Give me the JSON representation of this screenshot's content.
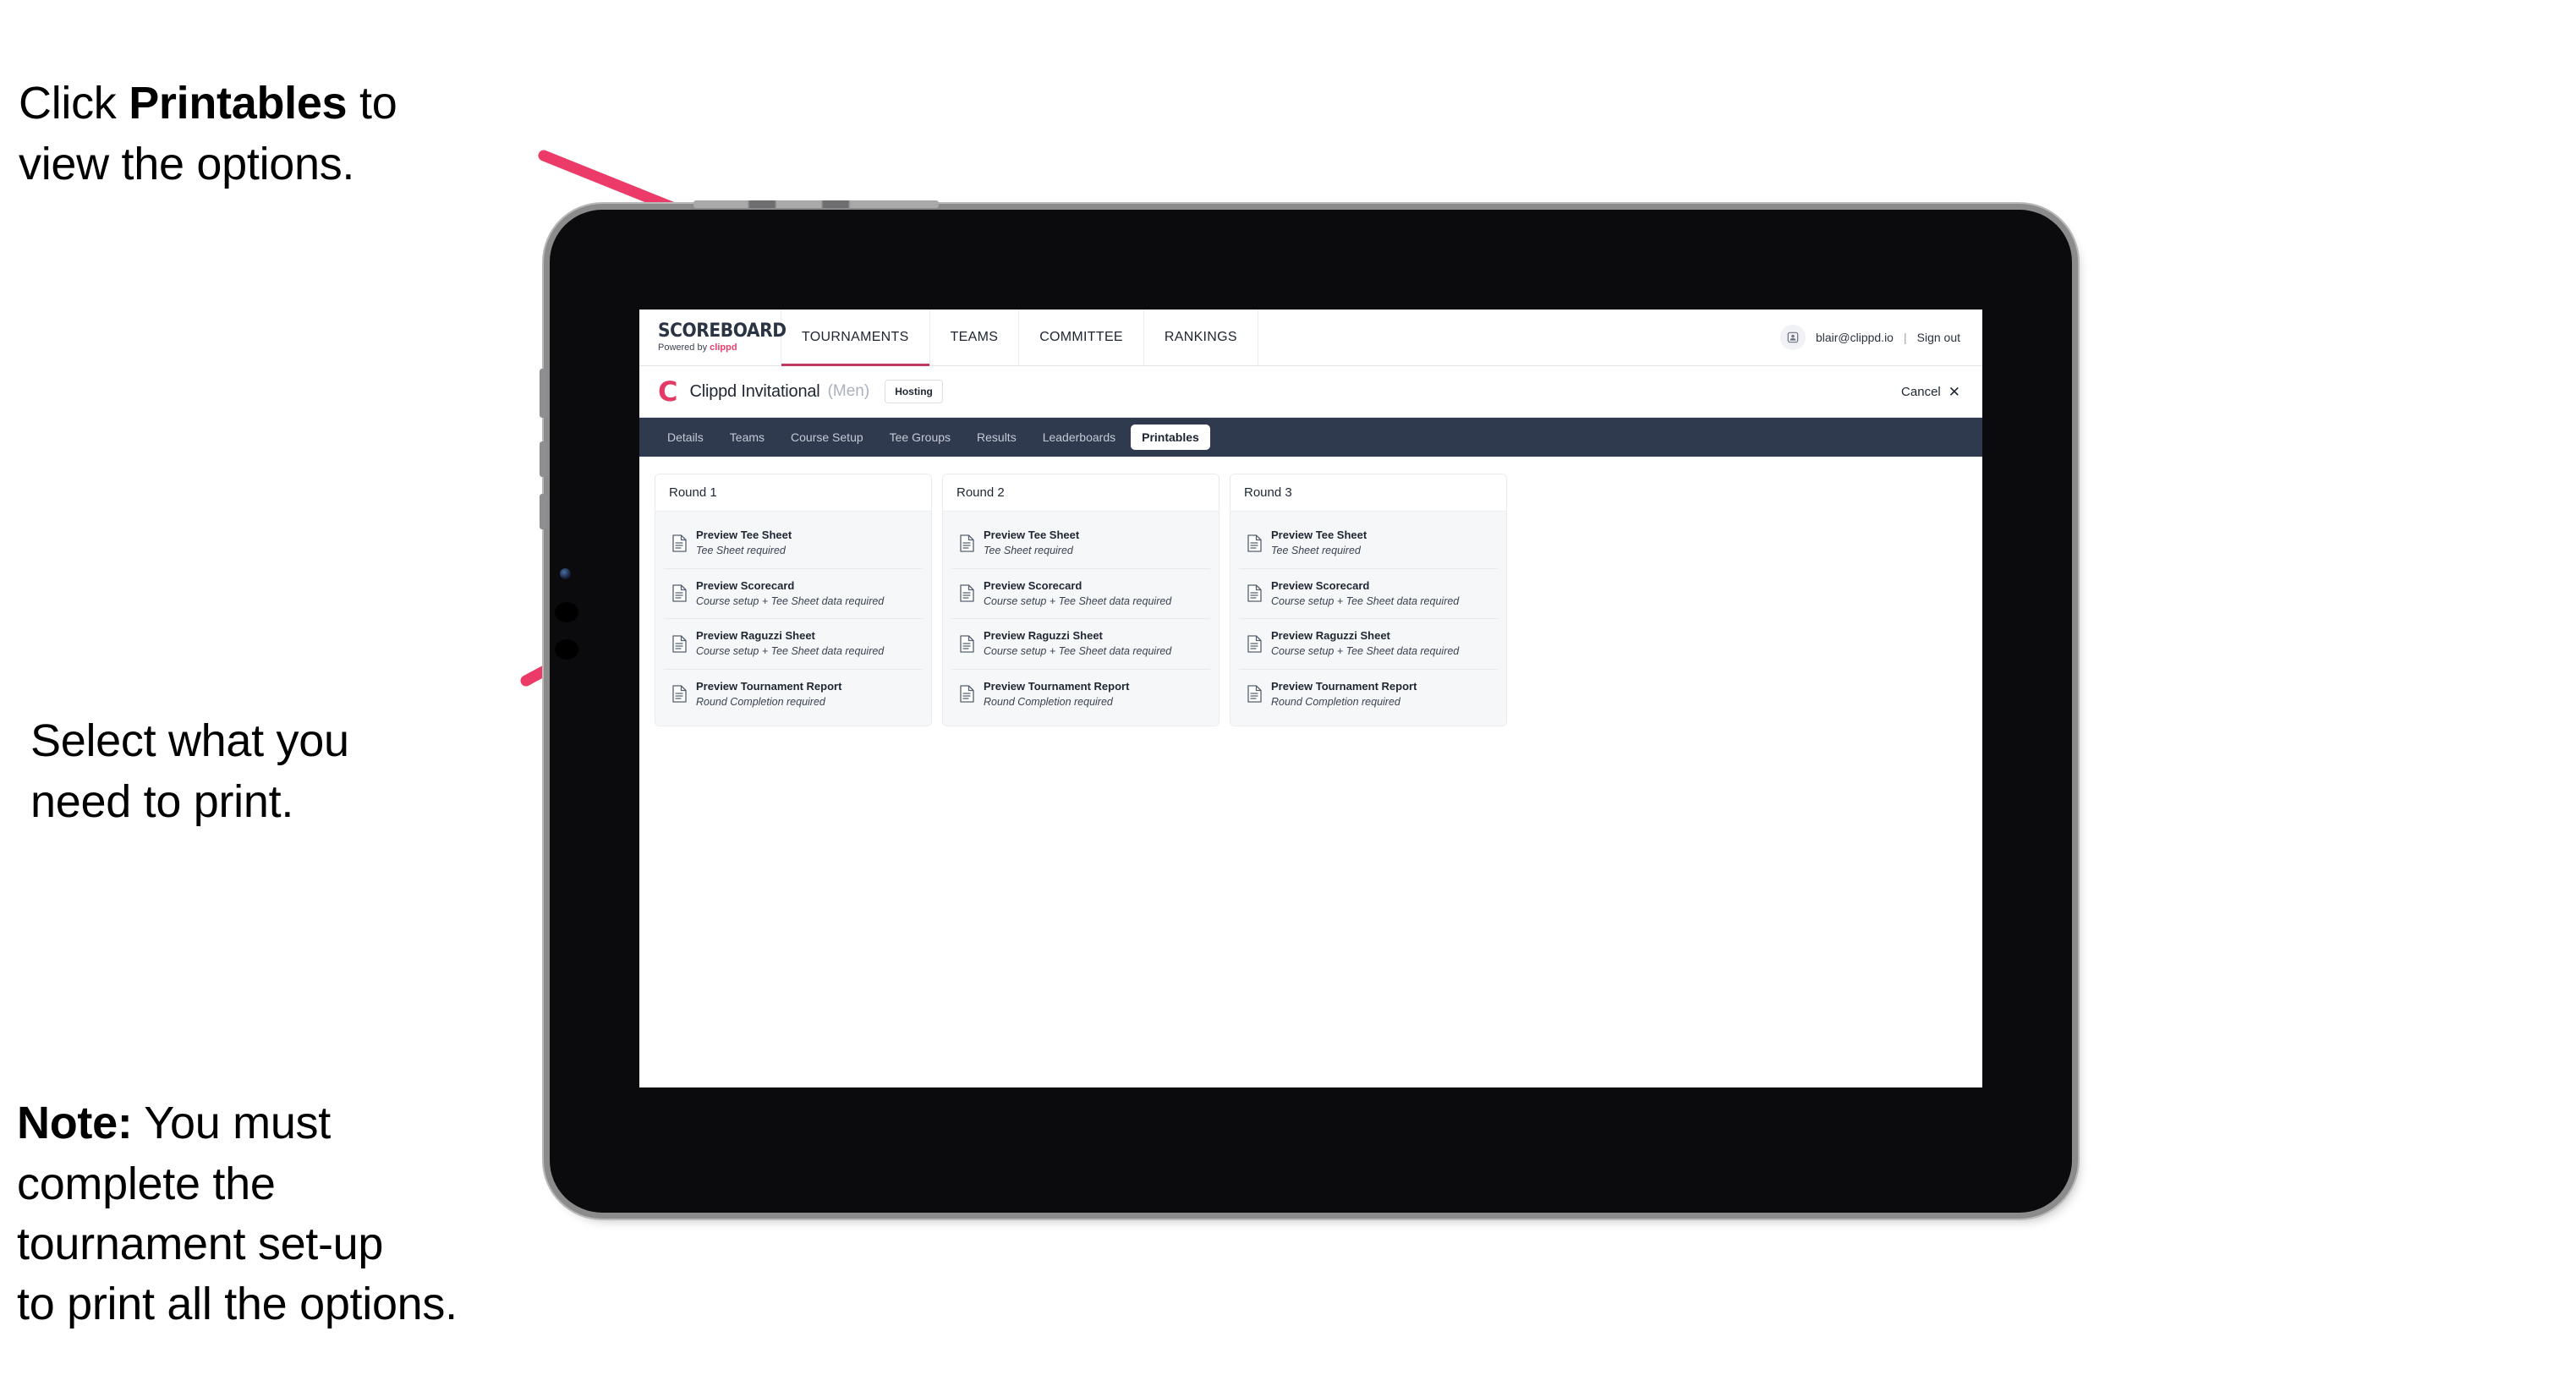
{
  "annotations": [
    {
      "id": "a1",
      "text_plain": "Click Printables to\nview the options.",
      "lead": "Click ",
      "bold": "Printables",
      "tail": " to\nview the options."
    },
    {
      "id": "a2",
      "text_plain": "Select what you\n need to print.",
      "lead": "Select what you\n need to print.",
      "bold": "",
      "tail": ""
    },
    {
      "id": "a3",
      "text_plain": "Note: You must\ncomplete the\ntournament set-up\nto print all the options.",
      "lead": "",
      "bold": "Note:",
      "tail": " You must\ncomplete the\ntournament set-up\nto print all the options."
    }
  ],
  "colors": {
    "arrow_pink": "#ec3b68",
    "tabstrip_navy": "#2f3a4f",
    "brand_pink": "#ec3f6d",
    "active_underline": "#c0395f",
    "bezel_black": "#0b0b0d",
    "bezel_rim": "#b9b9ba"
  },
  "topnav": {
    "logo_word": "SCOREBOARD",
    "logo_sub_prefix": "Powered by ",
    "logo_sub_brand": "clippd",
    "items": [
      {
        "label": "TOURNAMENTS",
        "active": true
      },
      {
        "label": "TEAMS",
        "active": false
      },
      {
        "label": "COMMITTEE",
        "active": false
      },
      {
        "label": "RANKINGS",
        "active": false
      }
    ],
    "avatar_icon": "user-avatar-icon",
    "user_email": "blair@clippd.io",
    "separator": "|",
    "sign_out": "Sign out"
  },
  "tournament_bar": {
    "logo_mark": "C",
    "title": "Clippd Invitational",
    "gender": "(Men)",
    "badge": "Hosting",
    "cancel_label": "Cancel",
    "cancel_icon": "close-x-icon"
  },
  "tabs": [
    {
      "label": "Details",
      "active": false
    },
    {
      "label": "Teams",
      "active": false
    },
    {
      "label": "Course Setup",
      "active": false
    },
    {
      "label": "Tee Groups",
      "active": false
    },
    {
      "label": "Results",
      "active": false
    },
    {
      "label": "Leaderboards",
      "active": false
    },
    {
      "label": "Printables",
      "active": true
    }
  ],
  "rounds": [
    {
      "title": "Round 1",
      "items": [
        {
          "icon": "document-icon",
          "title": "Preview Tee Sheet",
          "sub": "Tee Sheet required"
        },
        {
          "icon": "document-icon",
          "title": "Preview Scorecard",
          "sub": "Course setup + Tee Sheet data required"
        },
        {
          "icon": "document-icon",
          "title": "Preview Raguzzi Sheet",
          "sub": "Course setup + Tee Sheet data required"
        },
        {
          "icon": "document-icon",
          "title": "Preview Tournament Report",
          "sub": "Round Completion required"
        }
      ]
    },
    {
      "title": "Round 2",
      "items": [
        {
          "icon": "document-icon",
          "title": "Preview Tee Sheet",
          "sub": "Tee Sheet required"
        },
        {
          "icon": "document-icon",
          "title": "Preview Scorecard",
          "sub": "Course setup + Tee Sheet data required"
        },
        {
          "icon": "document-icon",
          "title": "Preview Raguzzi Sheet",
          "sub": "Course setup + Tee Sheet data required"
        },
        {
          "icon": "document-icon",
          "title": "Preview Tournament Report",
          "sub": "Round Completion required"
        }
      ]
    },
    {
      "title": "Round 3",
      "items": [
        {
          "icon": "document-icon",
          "title": "Preview Tee Sheet",
          "sub": "Tee Sheet required"
        },
        {
          "icon": "document-icon",
          "title": "Preview Scorecard",
          "sub": "Course setup + Tee Sheet data required"
        },
        {
          "icon": "document-icon",
          "title": "Preview Raguzzi Sheet",
          "sub": "Course setup + Tee Sheet data required"
        },
        {
          "icon": "document-icon",
          "title": "Preview Tournament Report",
          "sub": "Round Completion required"
        }
      ]
    }
  ]
}
